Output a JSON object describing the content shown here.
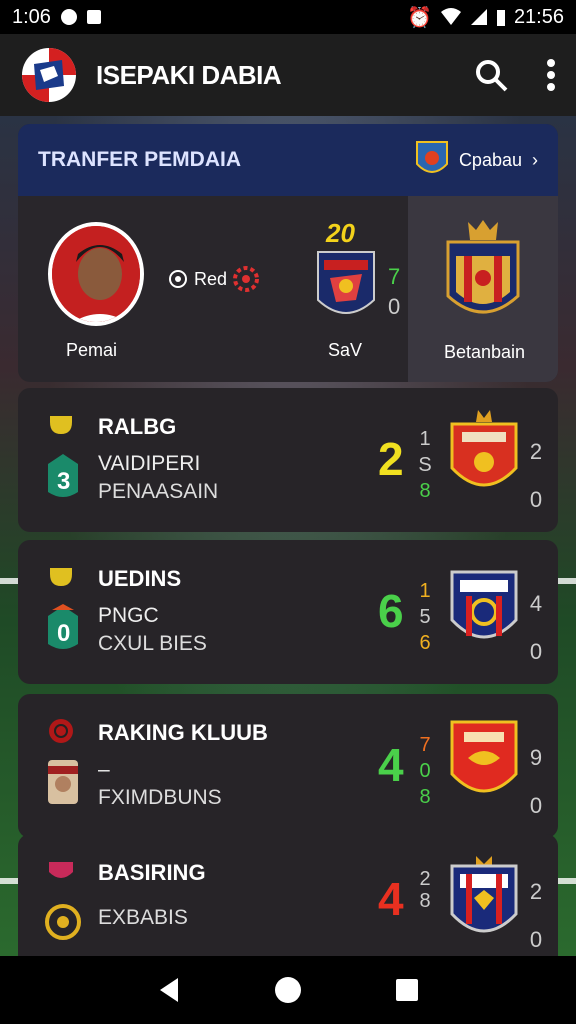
{
  "status": {
    "left_time": "1:06",
    "right_time": "21:56"
  },
  "app": {
    "title": "ISEPAKI DABIA"
  },
  "transfer": {
    "title": "TRANFER PEMDAIA",
    "club_label": "Cpabau",
    "player_name": "Pemai",
    "tag_label": "Red",
    "score": "20",
    "side_top": "7",
    "side_bottom": "0",
    "mid_label": "SaV",
    "right_label": "Betanbain"
  },
  "matches": [
    {
      "title": "RALBG",
      "line1": "VAIDIPERI",
      "line2": "PENAASAIN",
      "badge_num": "3",
      "big": "2",
      "big_color": "#f0e020",
      "tri": [
        "1",
        "S",
        "8"
      ],
      "tri_colors": [
        "#ccc",
        "#ccc",
        "#4ad04a"
      ],
      "score_top": "2",
      "score_bottom": "0"
    },
    {
      "title": "UEDINS",
      "line1": "PNGC",
      "line2": "CXUL BIES",
      "badge_num": "0",
      "big": "6",
      "big_color": "#4ad04a",
      "tri": [
        "1",
        "5",
        "6"
      ],
      "tri_colors": [
        "#f0b020",
        "#ccc",
        "#f0b020"
      ],
      "score_top": "4",
      "score_bottom": "0"
    },
    {
      "title": "RAKING KLUUB",
      "line1": "–",
      "line2": "FXIMDBUNS",
      "badge_num": "",
      "big": "4",
      "big_color": "#4ad04a",
      "tri": [
        "7",
        "0",
        "8"
      ],
      "tri_colors": [
        "#f07020",
        "#4ad04a",
        "#4ad04a"
      ],
      "score_top": "9",
      "score_bottom": "0"
    },
    {
      "title": "BASIRING",
      "line1": "",
      "line2": "EXBABIS",
      "badge_num": "",
      "big": "4",
      "big_color": "#e83020",
      "tri": [
        "2",
        "",
        "8"
      ],
      "tri_colors": [
        "#ccc",
        "#ccc",
        "#ccc"
      ],
      "score_top": "2",
      "score_bottom": "0"
    }
  ]
}
